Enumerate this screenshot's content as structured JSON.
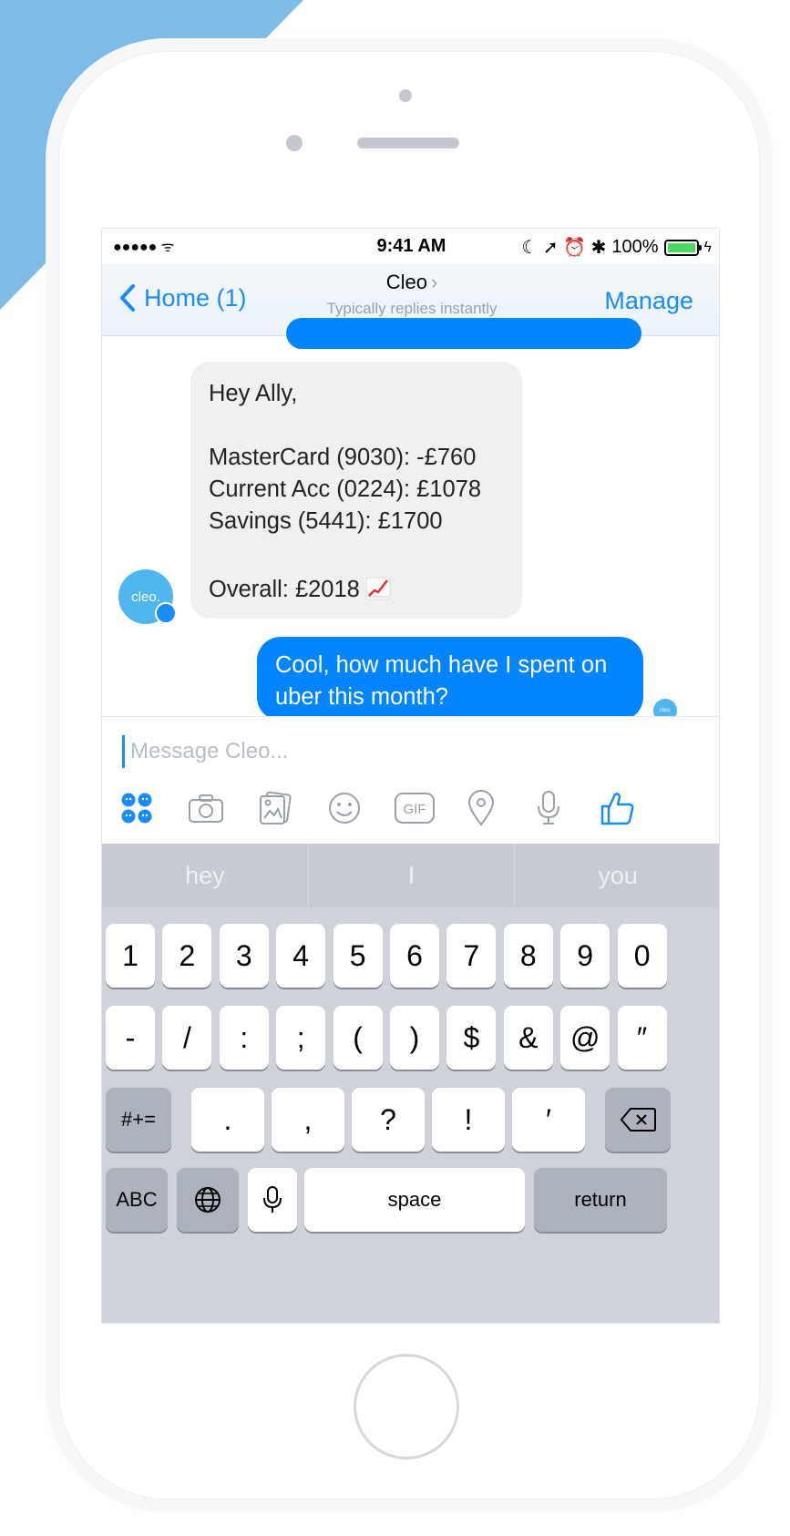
{
  "status_bar": {
    "signal": "●●●●● ᯤ",
    "time": "9:41 AM",
    "icons": "☾ ➚ ⏰ ✱",
    "battery_percent": "100%",
    "battery_level": 1.0
  },
  "nav": {
    "back_label": "Home (1)",
    "title": "Cleo",
    "subtitle": "Typically replies instantly",
    "manage_label": "Manage"
  },
  "messages": {
    "bot": {
      "line1": "Hey Ally,",
      "line2": "MasterCard (9030): -£760",
      "line3": "Current Acc (0224): £1078",
      "line4": "Savings (5441): £1700",
      "line5": "Overall: £2018",
      "emoji": "chart-increasing-icon"
    },
    "user": {
      "text": "Cool, how much have I spent on uber this month?"
    },
    "avatar_text": "cleo."
  },
  "composer": {
    "placeholder": "Message Cleo...",
    "tools": [
      "apps-icon",
      "camera-icon",
      "photo-icon",
      "emoji-icon",
      "gif-icon",
      "location-icon",
      "microphone-icon",
      "like-icon"
    ],
    "gif_label": "GIF"
  },
  "keyboard": {
    "suggestions": [
      "hey",
      "I",
      "you"
    ],
    "row1": [
      "1",
      "2",
      "3",
      "4",
      "5",
      "6",
      "7",
      "8",
      "9",
      "0"
    ],
    "row2": [
      "-",
      "/",
      ":",
      ";",
      "(",
      ")",
      "$",
      "&",
      "@",
      "″"
    ],
    "row3": [
      ".",
      ",",
      "?",
      "!",
      "′"
    ],
    "symbols_label": "#+=",
    "abc_label": "ABC",
    "space_label": "space",
    "return_label": "return"
  },
  "colors": {
    "accent": "#1a8cf7",
    "bubble_user": "#0084ff",
    "bubble_bot": "#f1f0f0",
    "background_shape": "#7fbde8"
  }
}
